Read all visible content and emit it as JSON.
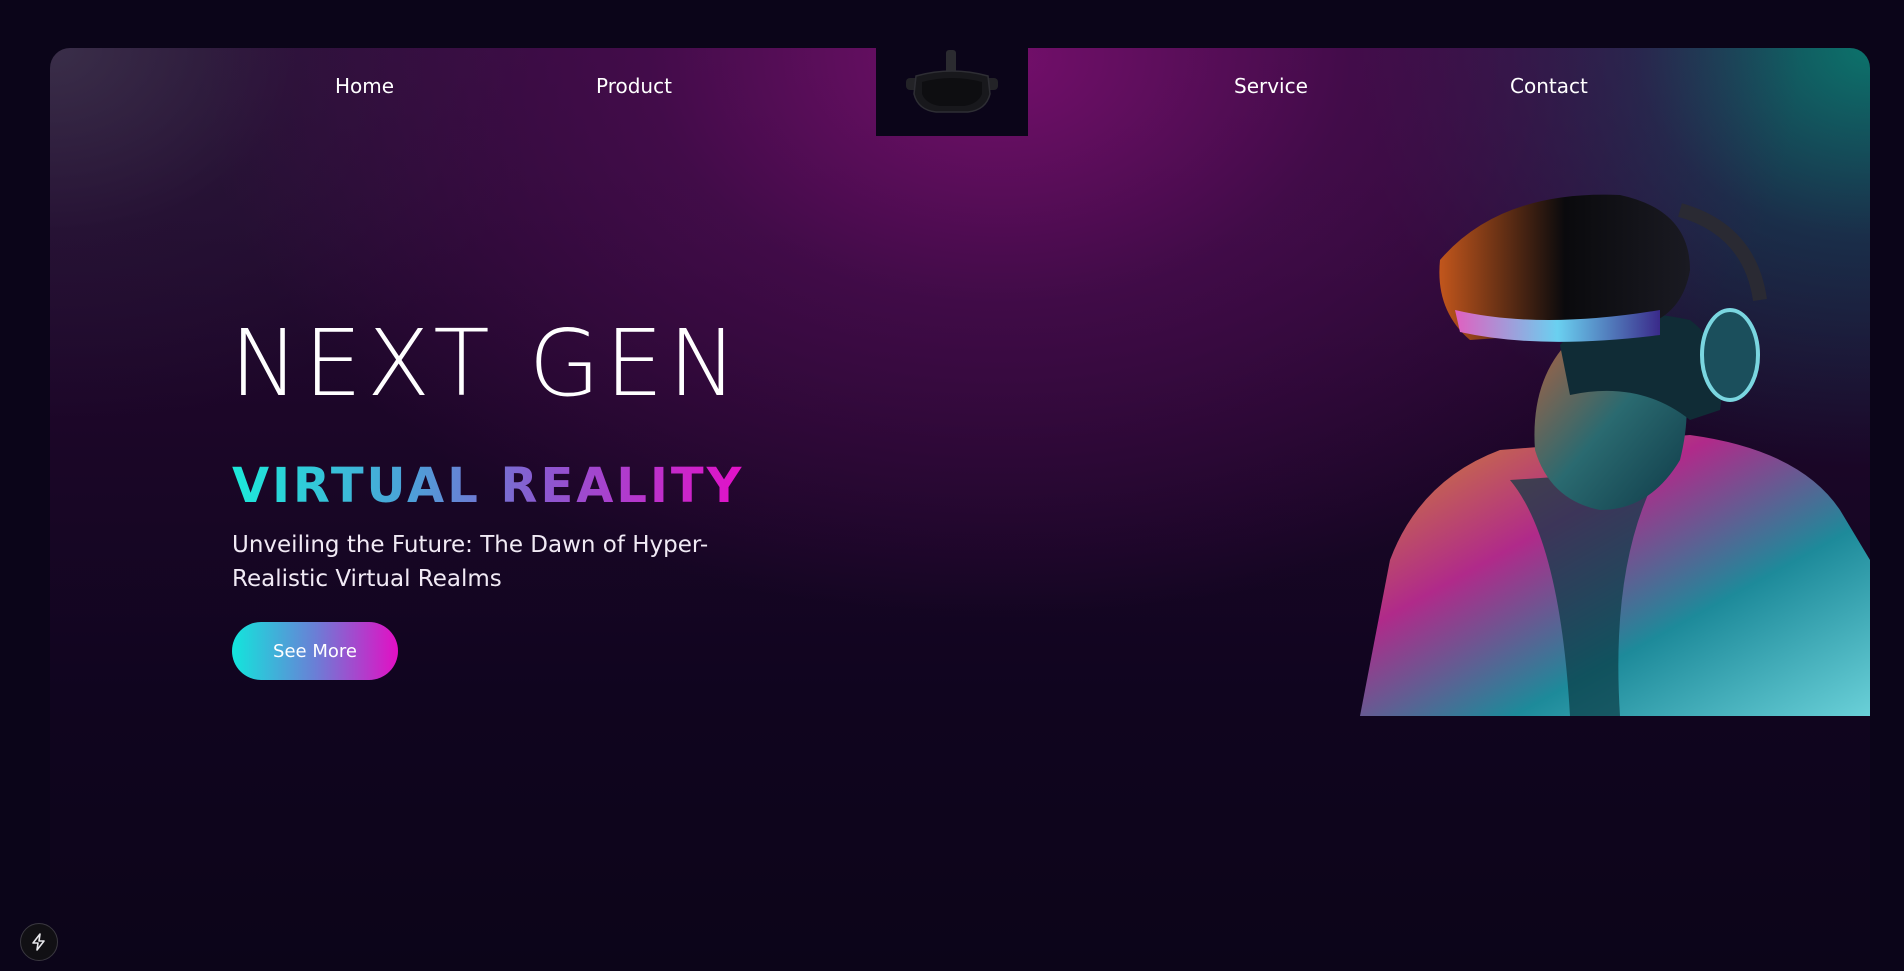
{
  "nav": {
    "items": [
      {
        "label": "Home"
      },
      {
        "label": "Product"
      },
      {
        "label": "Service"
      },
      {
        "label": "Contact"
      }
    ],
    "logo_icon": "vr-headset-icon"
  },
  "hero": {
    "title": "NEXT GEN",
    "subtitle": "VIRTUAL REALITY",
    "description": "Unveiling the Future: The Dawn of Hyper-Realistic Virtual Realms",
    "cta_label": "See More",
    "image_icon": "vr-person-illustration"
  },
  "colors": {
    "background": "#0b0519",
    "gradient_cyan": "#1ce9d9",
    "gradient_magenta": "#e410c8",
    "accent_purple": "#780f6e",
    "accent_teal": "#0a786e"
  },
  "floating": {
    "icon": "lightning-bolt-icon"
  }
}
